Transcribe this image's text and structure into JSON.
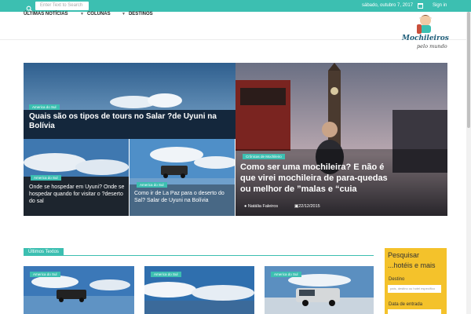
{
  "topbar": {
    "search_placeholder": "Enter Text to Search",
    "date": "sábado, outubro 7, 2017",
    "signin_label": "Sign in",
    "accent_color": "#3cbfb1"
  },
  "nav": {
    "items": [
      {
        "label": "ÚLTIMAS NOTÍCIAS",
        "has_chevron": false
      },
      {
        "label": "COLUNAS",
        "has_chevron": true
      },
      {
        "label": "DESTINOS",
        "has_chevron": true
      }
    ],
    "logo_text": "Mochileiros",
    "logo_sub": "pelo mundo"
  },
  "featured": {
    "main": {
      "tag": "America do Sul",
      "title": "Quais são os tipos de tours no Salar ?de Uyuni na Bolívia"
    },
    "small_left": {
      "tag": "America do Sul",
      "title": "Onde se hospedar em Uyuni? Onde se hospedar quando for visitar o ?deserto do sal"
    },
    "small_right": {
      "tag": "America do Sul",
      "title": "Como ir de La Paz para o deserto do Sal? Salar de Uyuni na Bolívia"
    },
    "big_right": {
      "tag": "Crônicas de Mochileiro",
      "title": "Como ser uma mochileira? E não é que virei mochileira de para-quedas ou melhor de ”malas e “cuia",
      "author": "Natália Faleiros",
      "date": "22/12/2015"
    }
  },
  "latest": {
    "section_label": "Últimos Textos",
    "cards": [
      {
        "tag": "America do Sul"
      },
      {
        "tag": "America do Sul"
      },
      {
        "tag": "America do Sul"
      }
    ]
  },
  "sidebar": {
    "title": "Pesquisar",
    "subtitle": "...hotéis e mais",
    "destino_label": "Destino",
    "destino_placeholder": "país, destino ou hotel específico",
    "data_label": "Data de entrada"
  }
}
